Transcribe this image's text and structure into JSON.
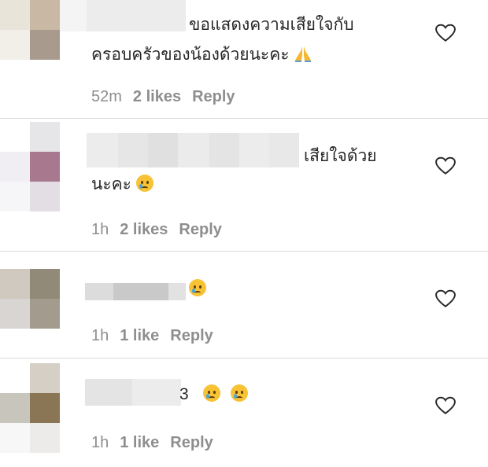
{
  "comments": [
    {
      "text_line1": "ขอแสดงความเสียใจกับ",
      "text_line2": "ครอบครัวของน้องด้วยนะคะ",
      "emoji": "pray-emoji",
      "time": "52m",
      "likes": "2 likes",
      "reply": "Reply"
    },
    {
      "text_line1": "เสียใจด้วย",
      "text_line2": "นะคะ",
      "emoji": "crying-face-emoji",
      "time": "1h",
      "likes": "2 likes",
      "reply": "Reply"
    },
    {
      "text_line1": "",
      "emoji": "crying-face-emoji",
      "time": "1h",
      "likes": "1 like",
      "reply": "Reply"
    },
    {
      "text_line1": "3",
      "emoji": "crying-face-emoji x2",
      "time": "1h",
      "likes": "1 like",
      "reply": "Reply"
    }
  ],
  "icons": {
    "like": "heart-outline-icon"
  },
  "colors": {
    "meta": "#8e8e8e",
    "text": "#262626",
    "divider": "#dbdbdb"
  }
}
